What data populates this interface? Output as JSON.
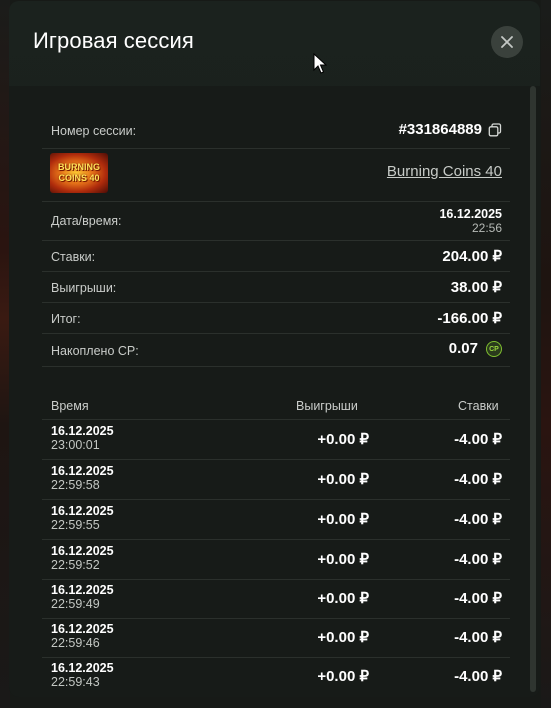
{
  "modal": {
    "title": "Игровая сессия"
  },
  "session": {
    "id_label": "Номер сессии:",
    "id_value": "#331864889",
    "game_name": "Burning Coins 40",
    "game_image_text_1": "BURNING",
    "game_image_text_2": "COINS 40",
    "datetime_label": "Дата/время:",
    "date": "16.12.2025",
    "time": "22:56",
    "bets_label": "Ставки:",
    "bets_value": "204.00 ₽",
    "wins_label": "Выигрыши:",
    "wins_value": "38.00 ₽",
    "total_label": "Итог:",
    "total_value": "-166.00 ₽",
    "cp_label": "Накоплено CP:",
    "cp_value": "0.07",
    "cp_icon_text": "CP"
  },
  "table": {
    "headers": {
      "time": "Время",
      "wins": "Выигрыши",
      "bets": "Ставки"
    },
    "rows": [
      {
        "date": "16.12.2025",
        "time": "23:00:01",
        "win": "+0.00 ₽",
        "bet": "-4.00 ₽"
      },
      {
        "date": "16.12.2025",
        "time": "22:59:58",
        "win": "+0.00 ₽",
        "bet": "-4.00 ₽"
      },
      {
        "date": "16.12.2025",
        "time": "22:59:55",
        "win": "+0.00 ₽",
        "bet": "-4.00 ₽"
      },
      {
        "date": "16.12.2025",
        "time": "22:59:52",
        "win": "+0.00 ₽",
        "bet": "-4.00 ₽"
      },
      {
        "date": "16.12.2025",
        "time": "22:59:49",
        "win": "+0.00 ₽",
        "bet": "-4.00 ₽"
      },
      {
        "date": "16.12.2025",
        "time": "22:59:46",
        "win": "+0.00 ₽",
        "bet": "-4.00 ₽"
      },
      {
        "date": "16.12.2025",
        "time": "22:59:43",
        "win": "+0.00 ₽",
        "bet": "-4.00 ₽"
      }
    ]
  },
  "colors": {
    "background": "#171b18",
    "divider": "#2b302c",
    "cp_accent": "#7fbf30"
  }
}
